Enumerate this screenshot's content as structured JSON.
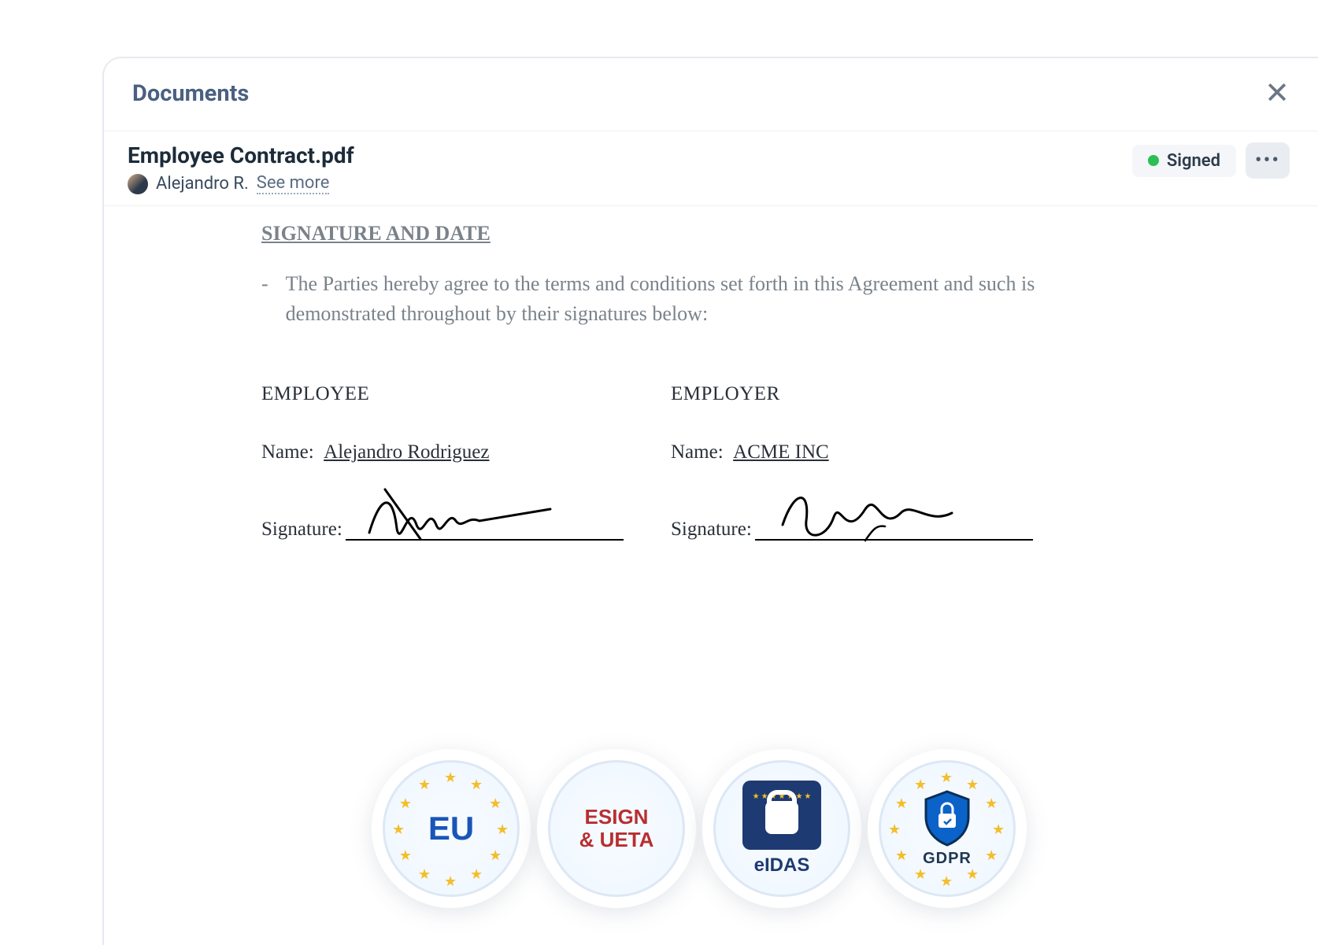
{
  "header": {
    "title": "Documents"
  },
  "document": {
    "filename": "Employee Contract.pdf",
    "owner": "Alejandro R.",
    "see_more": "See more",
    "status_label": "Signed",
    "status_color": "#2bbf55"
  },
  "contract": {
    "section_heading": "SIGNATURE AND DATE",
    "agreement_text": "The Parties hereby agree to the terms and conditions set forth in this Agreement and such is demonstrated throughout by their signatures below:",
    "employee": {
      "role": "EMPLOYEE",
      "name_label": "Name:",
      "name_value": "Alejandro Rodriguez",
      "signature_label": "Signature:"
    },
    "employer": {
      "role": "EMPLOYER",
      "name_label": "Name:",
      "name_value": "ACME INC",
      "signature_label": "Signature:"
    }
  },
  "badges": {
    "eu": "EU",
    "esign_line1": "ESIGN",
    "esign_line2": "& UETA",
    "eidas": "eIDAS",
    "gdpr": "GDPR"
  }
}
